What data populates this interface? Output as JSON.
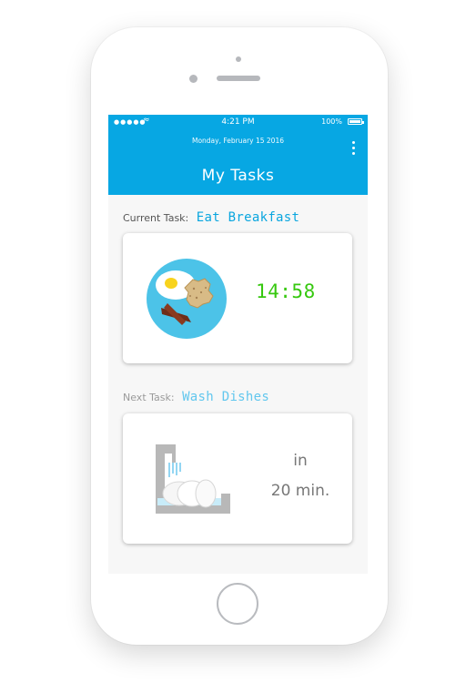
{
  "status_bar": {
    "signal": "●●●●●",
    "time": "4:21 PM",
    "battery": "100%"
  },
  "header": {
    "date": "Monday, February 15 2016",
    "title": "My Tasks",
    "more_icon": "more-vertical-icon"
  },
  "current_task": {
    "label": "Current Task:",
    "name": "Eat Breakfast",
    "timer": "14:58",
    "icon": "breakfast-plate-icon"
  },
  "next_task": {
    "label": "Next Task:",
    "name": "Wash Dishes",
    "in_text": "in",
    "duration": "20 min.",
    "icon": "dishes-sink-icon"
  },
  "colors": {
    "accent": "#07a7e3",
    "timer": "#36c80f"
  }
}
